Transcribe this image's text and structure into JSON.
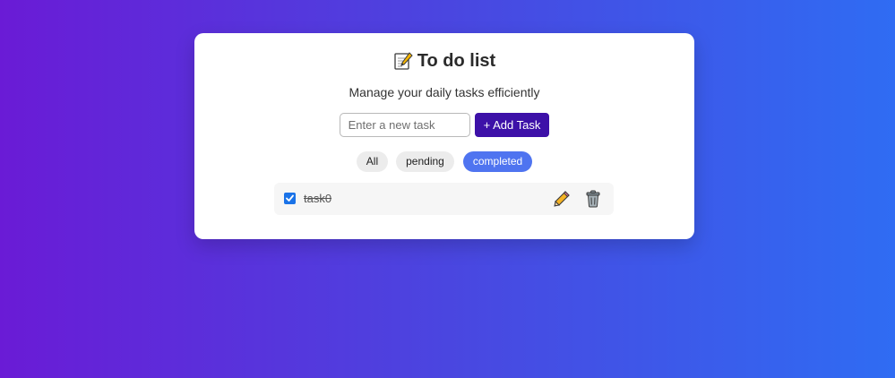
{
  "app": {
    "title": "To do list",
    "subtitle": "Manage your daily tasks efficiently"
  },
  "add_form": {
    "input_placeholder": "Enter a new task",
    "input_value": "",
    "add_button_label": "+ Add Task"
  },
  "filters": {
    "items": [
      {
        "label": "All",
        "active": false
      },
      {
        "label": "pending",
        "active": false
      },
      {
        "label": "completed",
        "active": true
      }
    ]
  },
  "tasks": [
    {
      "text": "task0",
      "completed": true,
      "edit_icon": "pencil-icon",
      "delete_icon": "trash-icon"
    }
  ],
  "icons": {
    "title_icon": "memo-icon"
  },
  "colors": {
    "bg_gradient_start": "#6a1bd6",
    "bg_gradient_end": "#2f6cf3",
    "add_button": "#3d11a8",
    "active_filter": "#4f74f0",
    "checkbox": "#1a73e8"
  }
}
